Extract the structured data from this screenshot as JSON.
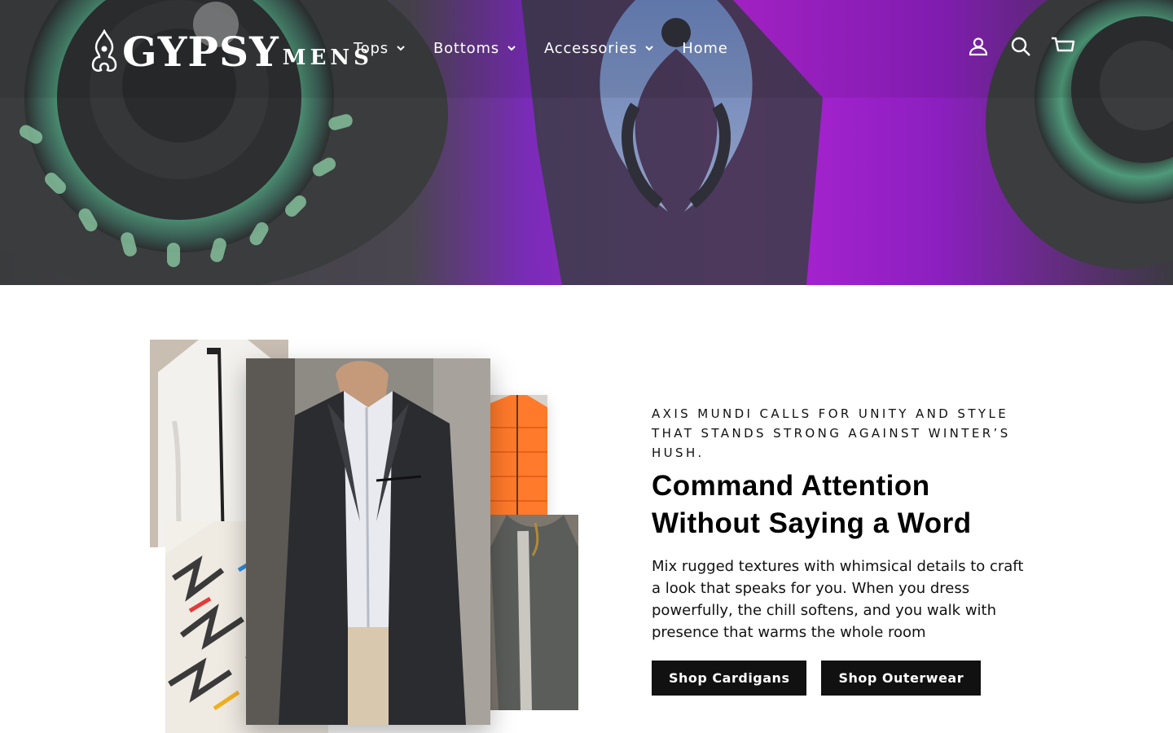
{
  "brand": {
    "logo_main": "GYPSY",
    "logo_sub": "MENS"
  },
  "nav": {
    "items": [
      {
        "label": "Tops",
        "has_dropdown": true
      },
      {
        "label": "Bottoms",
        "has_dropdown": true
      },
      {
        "label": "Accessories",
        "has_dropdown": true
      },
      {
        "label": "Home",
        "has_dropdown": false
      }
    ]
  },
  "header_icons": [
    "account-icon",
    "search-icon",
    "cart-icon"
  ],
  "hero": {
    "colors": {
      "purple": "#9b1fd6",
      "magenta": "#c21fc8",
      "teal": "#3f7a6a",
      "dark": "#2b2a2e"
    }
  },
  "feature": {
    "eyebrow": "Axis Mundi calls for unity and style that stands strong against winter’s hush.",
    "headline": "Command Attention Without Saying a Word",
    "body": "Mix rugged textures with whimsical details to craft a look that speaks for you. When you dress powerfully, the chill softens, and you walk with presence that warms the whole room",
    "buttons": [
      {
        "label": "Shop Cardigans"
      },
      {
        "label": "Shop Outerwear"
      }
    ]
  },
  "colors": {
    "button_bg": "#111111",
    "button_text": "#ffffff",
    "text": "#000000"
  }
}
